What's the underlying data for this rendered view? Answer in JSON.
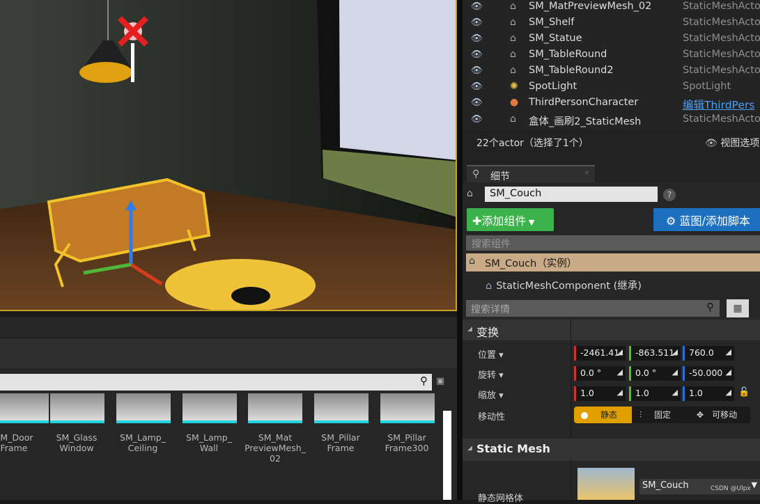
{
  "outliner": {
    "rows": [
      {
        "name": "SM_MatPreviewMesh_02",
        "type": "StaticMeshActor",
        "icon": "static-mesh-icon"
      },
      {
        "name": "SM_Shelf",
        "type": "StaticMeshActor",
        "icon": "static-mesh-icon"
      },
      {
        "name": "SM_Statue",
        "type": "StaticMeshActor",
        "icon": "static-mesh-icon"
      },
      {
        "name": "SM_TableRound",
        "type": "StaticMeshActor",
        "icon": "static-mesh-icon"
      },
      {
        "name": "SM_TableRound2",
        "type": "StaticMeshActor",
        "icon": "static-mesh-icon"
      },
      {
        "name": "SpotLight",
        "type": "SpotLight",
        "icon": "spotlight-icon"
      },
      {
        "name": "ThirdPersonCharacter",
        "type": "编辑ThirdPers",
        "icon": "character-icon"
      },
      {
        "name": "盒体_画刷2_StaticMesh",
        "type": "StaticMeshActor",
        "icon": "static-mesh-icon"
      }
    ],
    "count": "22个actor（选择了1个）",
    "view_options": "视图选项"
  },
  "details": {
    "tab": "细节",
    "name": "SM_Couch",
    "add_component": "添加组件",
    "blueprint": "蓝图/添加脚本",
    "search_components": "搜索组件",
    "instance": "SM_Couch（实例）",
    "component": "StaticMeshComponent (继承)",
    "search_details": "搜索详情",
    "transform": {
      "title": "变换",
      "location_label": "位置",
      "location": [
        "-2461.41",
        "-863.511",
        "760.0"
      ],
      "rotation_label": "旋转",
      "rotation": [
        "0.0 °",
        "0.0 °",
        "-50.000"
      ],
      "scale_label": "缩放",
      "scale": [
        "1.0",
        "1.0",
        "1.0"
      ],
      "mobility_label": "移动性",
      "mobility": [
        "静态",
        "固定",
        "可移动"
      ]
    },
    "static_mesh": {
      "title": "Static Mesh",
      "label": "静态网格体",
      "value": "SM_Couch"
    }
  },
  "content": {
    "assets": [
      "SM_Door\nFrame",
      "SM_Glass\nWindow",
      "SM_Lamp_\nCeiling",
      "SM_Lamp_\nWall",
      "SM_Mat\nPreviewMesh_\n02",
      "SM_Pillar\nFrame",
      "SM_Pillar\nFrame300"
    ]
  },
  "watermark": "CSDN @Ulpx",
  "colors": {
    "selection": "#e8b020",
    "accent_green": "#3cb34a",
    "accent_blue": "#1d6fc0",
    "instance_bg": "#c8ab86"
  }
}
